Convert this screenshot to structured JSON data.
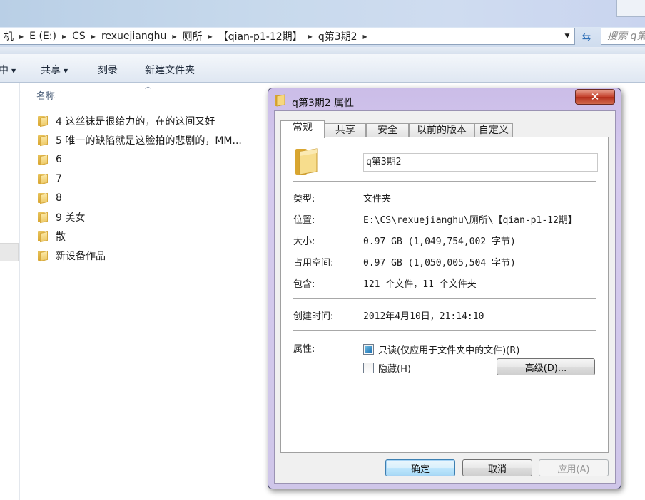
{
  "explorer": {
    "breadcrumbs": [
      "机",
      "E (E:)",
      "CS",
      "rexuejianghu",
      "厕所",
      "【qian-p1-12期】",
      "q第3期2"
    ],
    "search_placeholder": "搜索 q第",
    "toolbar": {
      "partial_label": "中",
      "share_label": "共享",
      "burn_label": "刻录",
      "new_folder_label": "新建文件夹"
    },
    "column_header": "名称",
    "files": [
      {
        "name": "4 这丝袜是很给力的，在的这间又好"
      },
      {
        "name": "5 唯一的缺陷就是这脸拍的悲剧的，MM..."
      },
      {
        "name": "6"
      },
      {
        "name": "7"
      },
      {
        "name": "8"
      },
      {
        "name": "9 美女"
      },
      {
        "name": "散"
      },
      {
        "name": "新设备作品"
      }
    ]
  },
  "dialog": {
    "title": "q第3期2 属性",
    "close_label": "✕",
    "tabs": [
      {
        "label": "常规",
        "active": true
      },
      {
        "label": "共享"
      },
      {
        "label": "安全"
      },
      {
        "label": "以前的版本"
      },
      {
        "label": "自定义"
      }
    ],
    "folder_name": "q第3期2",
    "props": {
      "type_label": "类型:",
      "type_value": "文件夹",
      "location_label": "位置:",
      "location_value": "E:\\CS\\rexuejianghu\\厕所\\【qian-p1-12期】",
      "size_label": "大小:",
      "size_value": "0.97 GB (1,049,754,002 字节)",
      "disk_label": "占用空间:",
      "disk_value": "0.97 GB (1,050,005,504 字节)",
      "contains_label": "包含:",
      "contains_value": "121 个文件，11 个文件夹",
      "created_label": "创建时间:",
      "created_value": "2012年4月10日，21:14:10",
      "attributes_label": "属性:",
      "readonly_label": "只读(仅应用于文件夹中的文件)(R)",
      "readonly_state": "indeterminate",
      "hidden_label": "隐藏(H)",
      "hidden_state": "unchecked",
      "advanced_label": "高级(D)..."
    },
    "buttons": {
      "ok": "确定",
      "cancel": "取消",
      "apply": "应用(A)"
    }
  },
  "colors": {
    "dialog_frame": "#cbbde8",
    "close_button": "#c4412c",
    "primary_button": "#bee6fd"
  }
}
